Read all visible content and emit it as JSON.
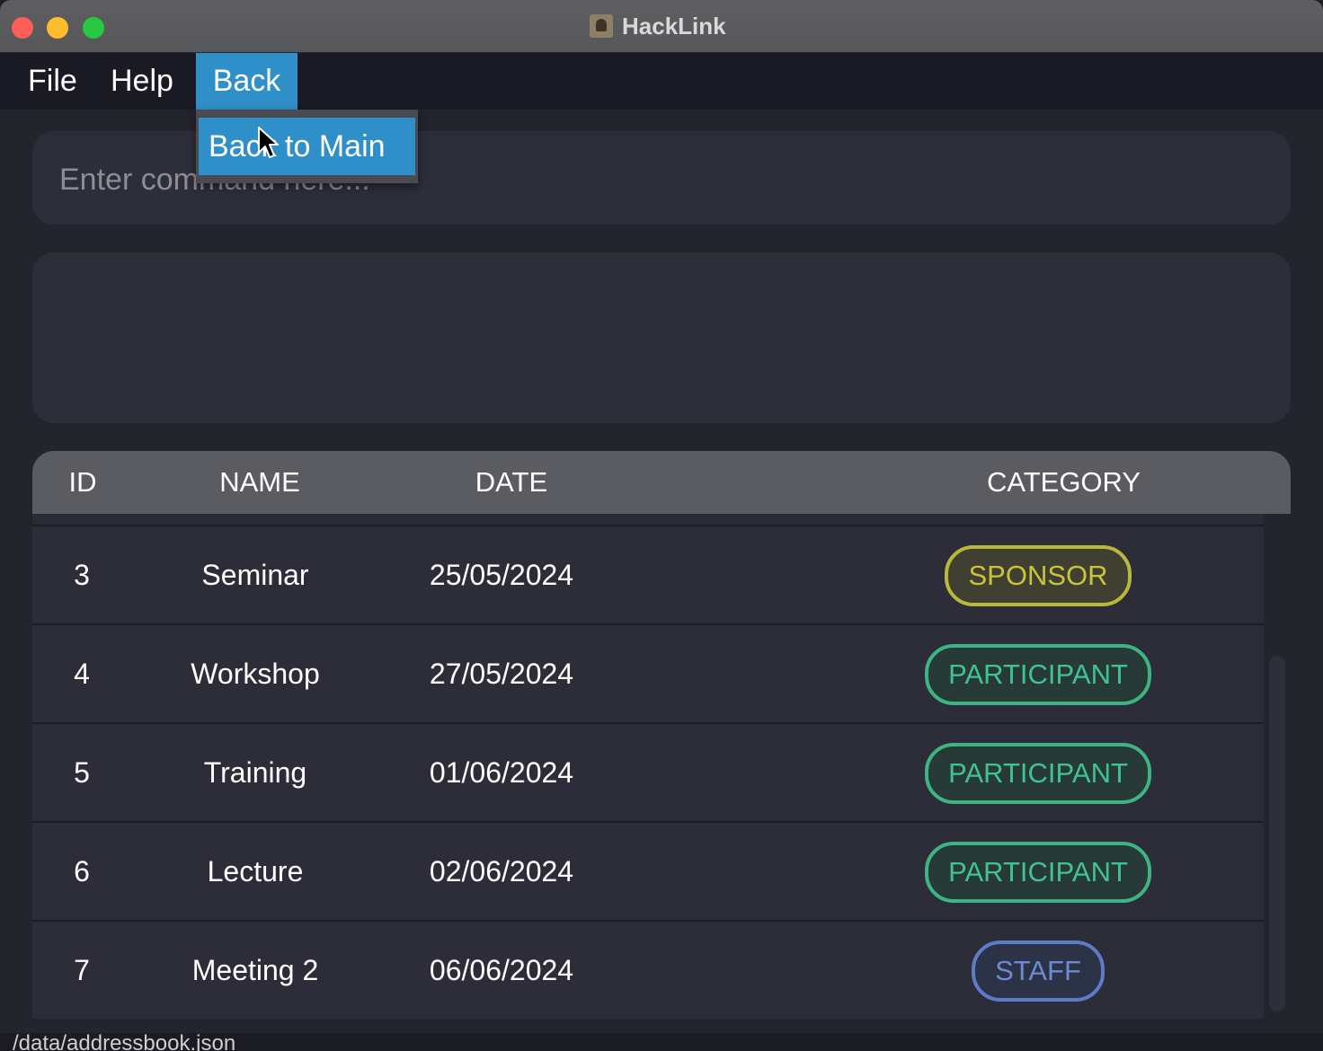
{
  "window": {
    "title": "HackLink"
  },
  "menu": {
    "file": "File",
    "help": "Help",
    "back": "Back"
  },
  "dropdown": {
    "item": "Back to Main"
  },
  "command": {
    "placeholder": "Enter command here..."
  },
  "result": {
    "text": ""
  },
  "table": {
    "headers": {
      "id": "ID",
      "name": "NAME",
      "date": "DATE",
      "category": "CATEGORY"
    },
    "rows": [
      {
        "id": "3",
        "name": "Seminar",
        "date": "25/05/2024",
        "category": "SPONSOR"
      },
      {
        "id": "4",
        "name": "Workshop",
        "date": "27/05/2024",
        "category": "PARTICIPANT"
      },
      {
        "id": "5",
        "name": "Training",
        "date": "01/06/2024",
        "category": "PARTICIPANT"
      },
      {
        "id": "6",
        "name": "Lecture",
        "date": "02/06/2024",
        "category": "PARTICIPANT"
      },
      {
        "id": "7",
        "name": "Meeting 2",
        "date": "06/06/2024",
        "category": "STAFF"
      }
    ]
  },
  "status": {
    "path": "/data/addressbook.json"
  },
  "colors": {
    "accent": "#2f8fc8",
    "sponsor": "#c9c43a",
    "participant": "#40c291",
    "staff": "#6b8bd2"
  },
  "icons": {
    "app": "person-icon",
    "cursor": "pointer-cursor-icon"
  }
}
